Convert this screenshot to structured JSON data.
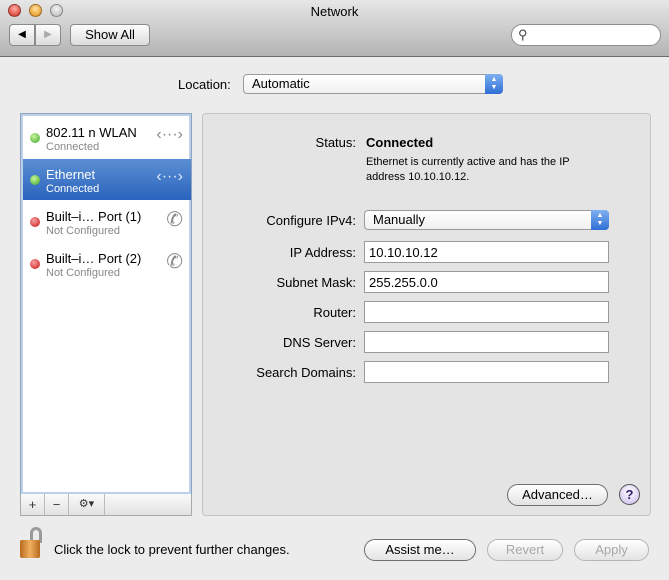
{
  "window": {
    "title": "Network"
  },
  "toolbar": {
    "back": "◀",
    "forward": "▶",
    "show_all": "Show All",
    "search_placeholder": ""
  },
  "location": {
    "label": "Location:",
    "value": "Automatic"
  },
  "services": [
    {
      "name": "802.11 n WLAN",
      "status": "Connected",
      "dot": "green",
      "icon": "wifi-arrows-icon",
      "selected": false
    },
    {
      "name": "Ethernet",
      "status": "Connected",
      "dot": "green",
      "icon": "ethernet-arrows-icon",
      "selected": true
    },
    {
      "name": "Built–i… Port (1)",
      "status": "Not Configured",
      "dot": "red",
      "icon": "phone-icon",
      "selected": false
    },
    {
      "name": "Built–i… Port (2)",
      "status": "Not Configured",
      "dot": "red",
      "icon": "phone-icon",
      "selected": false
    }
  ],
  "list_bar": {
    "add": "+",
    "remove": "−",
    "gear": "⚙▾"
  },
  "detail": {
    "status_label": "Status:",
    "status_value": "Connected",
    "status_desc": "Ethernet is currently active and has the IP address 10.10.10.12.",
    "configure_label": "Configure IPv4:",
    "configure_value": "Manually",
    "ip_label": "IP Address:",
    "ip_value": "10.10.10.12",
    "subnet_label": "Subnet Mask:",
    "subnet_value": "255.255.0.0",
    "router_label": "Router:",
    "router_value": "",
    "dns_label": "DNS Server:",
    "dns_value": "",
    "search_label": "Search Domains:",
    "search_value": "",
    "advanced": "Advanced…",
    "help": "?"
  },
  "footer": {
    "lock_text": "Click the lock to prevent further changes.",
    "assist": "Assist me…",
    "revert": "Revert",
    "apply": "Apply"
  }
}
